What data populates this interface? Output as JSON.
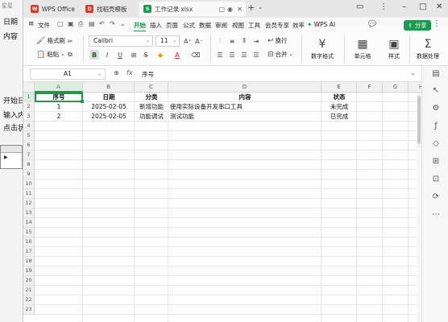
{
  "background_app": {
    "title": "星星",
    "labels": [
      "日期",
      "内容",
      "开始日",
      "输入内",
      "点击状"
    ]
  },
  "tabs": [
    {
      "label": "WPS Office",
      "icon": "wps-logo-icon",
      "color": "#d83b2b"
    },
    {
      "label": "找稻壳模板",
      "icon": "docer-icon",
      "color": "#d83b2b"
    },
    {
      "label": "工作记录.xlsx",
      "icon": "sheet-icon",
      "color": "#1a9a4c"
    }
  ],
  "menubar": {
    "file": "文件",
    "items": [
      "开始",
      "插入",
      "页面",
      "公式",
      "数据",
      "审阅",
      "视图",
      "工具",
      "会员专享",
      "效率"
    ],
    "active": "开始",
    "wps_ai": "WPS AI",
    "share": "分享"
  },
  "ribbon": {
    "format_painter": "格式刷",
    "paste": "粘贴",
    "font_name": "Calibri",
    "font_size": "11",
    "wrap": "换行",
    "merge": "合并",
    "number_format": "数字格式",
    "cell_format": "单元格",
    "style": "样式",
    "data_process": "数据处理"
  },
  "formula_bar": {
    "name_box": "A1",
    "fx": "fx",
    "value": "序号"
  },
  "sheet": {
    "columns": [
      "A",
      "B",
      "C",
      "D",
      "E",
      "F",
      "G",
      "H"
    ],
    "rows": [
      "1",
      "2",
      "3",
      "4",
      "5",
      "6",
      "7",
      "8",
      "9",
      "10",
      "11",
      "12",
      "13",
      "14",
      "15",
      "16",
      "17",
      "18",
      "19",
      "20",
      "21",
      "22",
      "23"
    ],
    "headers": [
      "序号",
      "日期",
      "分类",
      "内容",
      "状态"
    ],
    "data": [
      [
        "1",
        "2025-02-05",
        "新增功能",
        "使用实际设备开发串口工具",
        "未完成"
      ],
      [
        "2",
        "2025-02-05",
        "功能调试",
        "测试功能",
        "已完成"
      ]
    ]
  },
  "colors": {
    "accent": "#1a9a4c",
    "selection_bg": "#dbeedf"
  }
}
